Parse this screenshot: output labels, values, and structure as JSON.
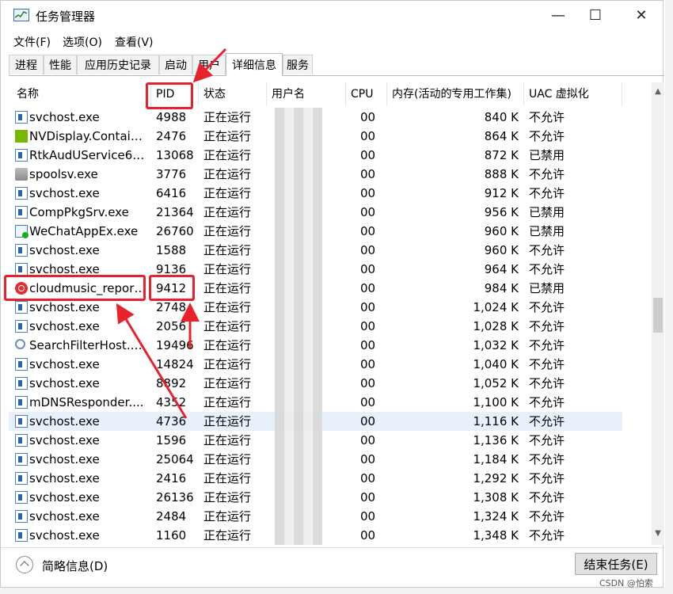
{
  "window": {
    "title": "任务管理器",
    "controls": {
      "minimize": "—",
      "maximize": "☐",
      "close": "✕"
    }
  },
  "menu": [
    "文件(F)",
    "选项(O)",
    "查看(V)"
  ],
  "tabs": [
    {
      "label": "进程",
      "active": false
    },
    {
      "label": "性能",
      "active": false
    },
    {
      "label": "应用历史记录",
      "active": false
    },
    {
      "label": "启动",
      "active": false
    },
    {
      "label": "用户",
      "active": false
    },
    {
      "label": "详细信息",
      "active": true
    },
    {
      "label": "服务",
      "active": false
    }
  ],
  "columns": {
    "name": "名称",
    "pid": "PID",
    "status": "状态",
    "user": "用户名",
    "cpu": "CPU",
    "memory": "内存(活动的专用工作集)",
    "uac": "UAC 虚拟化"
  },
  "rows": [
    {
      "name": "svchost.exe",
      "icon": "exe-icon",
      "pid": "4988",
      "status": "正在运行",
      "cpu": "00",
      "memory": "840 K",
      "uac": "不允许"
    },
    {
      "name": "NVDisplay.Contain...",
      "icon": "nvidia-icon",
      "pid": "2476",
      "status": "正在运行",
      "cpu": "00",
      "memory": "864 K",
      "uac": "不允许"
    },
    {
      "name": "RtkAudUService64....",
      "icon": "exe-icon",
      "pid": "13068",
      "status": "正在运行",
      "cpu": "00",
      "memory": "872 K",
      "uac": "已禁用"
    },
    {
      "name": "spoolsv.exe",
      "icon": "printer-icon",
      "pid": "3776",
      "status": "正在运行",
      "cpu": "00",
      "memory": "888 K",
      "uac": "不允许"
    },
    {
      "name": "svchost.exe",
      "icon": "exe-icon",
      "pid": "6416",
      "status": "正在运行",
      "cpu": "00",
      "memory": "912 K",
      "uac": "不允许"
    },
    {
      "name": "CompPkgSrv.exe",
      "icon": "exe-icon",
      "pid": "21364",
      "status": "正在运行",
      "cpu": "00",
      "memory": "956 K",
      "uac": "已禁用"
    },
    {
      "name": "WeChatAppEx.exe",
      "icon": "wechat-icon",
      "pid": "26760",
      "status": "正在运行",
      "cpu": "00",
      "memory": "960 K",
      "uac": "已禁用"
    },
    {
      "name": "svchost.exe",
      "icon": "exe-icon",
      "pid": "1588",
      "status": "正在运行",
      "cpu": "00",
      "memory": "960 K",
      "uac": "不允许"
    },
    {
      "name": "svchost.exe",
      "icon": "exe-icon",
      "pid": "9136",
      "status": "正在运行",
      "cpu": "00",
      "memory": "964 K",
      "uac": "不允许"
    },
    {
      "name": "cloudmusic_report...",
      "icon": "netease-music-icon",
      "pid": "9412",
      "status": "正在运行",
      "cpu": "00",
      "memory": "984 K",
      "uac": "已禁用"
    },
    {
      "name": "svchost.exe",
      "icon": "exe-icon",
      "pid": "2748",
      "status": "正在运行",
      "cpu": "00",
      "memory": "1,024 K",
      "uac": "不允许"
    },
    {
      "name": "svchost.exe",
      "icon": "exe-icon",
      "pid": "2056",
      "status": "正在运行",
      "cpu": "00",
      "memory": "1,028 K",
      "uac": "不允许"
    },
    {
      "name": "SearchFilterHost.e...",
      "icon": "search-icon",
      "pid": "19496",
      "status": "正在运行",
      "cpu": "00",
      "memory": "1,032 K",
      "uac": "不允许"
    },
    {
      "name": "svchost.exe",
      "icon": "exe-icon",
      "pid": "14824",
      "status": "正在运行",
      "cpu": "00",
      "memory": "1,040 K",
      "uac": "不允许"
    },
    {
      "name": "svchost.exe",
      "icon": "exe-icon",
      "pid": "8892",
      "status": "正在运行",
      "cpu": "00",
      "memory": "1,052 K",
      "uac": "不允许"
    },
    {
      "name": "mDNSResponder....",
      "icon": "exe-icon",
      "pid": "4352",
      "status": "正在运行",
      "cpu": "00",
      "memory": "1,100 K",
      "uac": "不允许"
    },
    {
      "name": "svchost.exe",
      "icon": "exe-icon",
      "pid": "4736",
      "status": "正在运行",
      "cpu": "00",
      "memory": "1,116 K",
      "uac": "不允许",
      "selected": true
    },
    {
      "name": "svchost.exe",
      "icon": "exe-icon",
      "pid": "1596",
      "status": "正在运行",
      "cpu": "00",
      "memory": "1,136 K",
      "uac": "不允许"
    },
    {
      "name": "svchost.exe",
      "icon": "exe-icon",
      "pid": "25064",
      "status": "正在运行",
      "cpu": "00",
      "memory": "1,184 K",
      "uac": "不允许"
    },
    {
      "name": "svchost.exe",
      "icon": "exe-icon",
      "pid": "2416",
      "status": "正在运行",
      "cpu": "00",
      "memory": "1,292 K",
      "uac": "不允许"
    },
    {
      "name": "svchost.exe",
      "icon": "exe-icon",
      "pid": "26136",
      "status": "正在运行",
      "cpu": "00",
      "memory": "1,308 K",
      "uac": "不允许"
    },
    {
      "name": "svchost.exe",
      "icon": "exe-icon",
      "pid": "2484",
      "status": "正在运行",
      "cpu": "00",
      "memory": "1,324 K",
      "uac": "不允许"
    },
    {
      "name": "svchost.exe",
      "icon": "exe-icon",
      "pid": "1160",
      "status": "正在运行",
      "cpu": "00",
      "memory": "1,348 K",
      "uac": "不允许"
    }
  ],
  "footer": {
    "fewer_details": "简略信息(D)",
    "end_task": "结束任务(E)"
  },
  "watermark": "CSDN @怕索",
  "colors": {
    "annotation": "#e8222a",
    "selected_row": "#e8f1fb"
  }
}
